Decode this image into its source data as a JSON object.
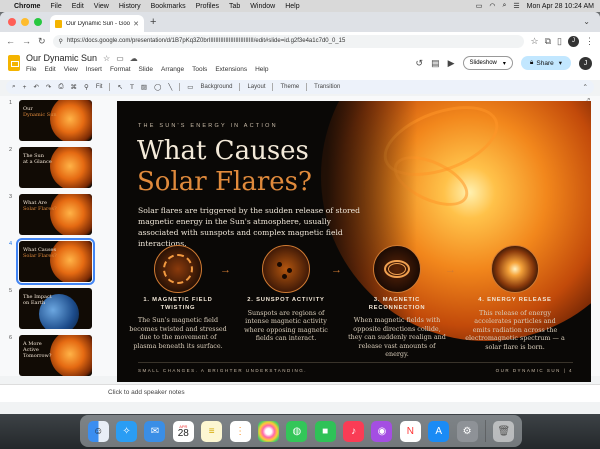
{
  "menubar": {
    "app": "Chrome",
    "items": [
      "File",
      "Edit",
      "View",
      "History",
      "Bookmarks",
      "Profiles",
      "Tab",
      "Window",
      "Help"
    ],
    "datetime": "Mon Apr 28  10:24 AM"
  },
  "browser": {
    "tab_title": "Our Dynamic Sun - Google Slides",
    "url": "https://docs.google.com/presentation/d/1B7pKq3Z0brIIIIIIIIIIIIIIIIIIIIIIIIIII/edit#slide=id.g2f3e4a1c7d0_0_15",
    "profile_initial": "J"
  },
  "doc": {
    "title": "Our Dynamic Sun",
    "menu": [
      "File",
      "Edit",
      "View",
      "Insert",
      "Format",
      "Slide",
      "Arrange",
      "Tools",
      "Extensions",
      "Help"
    ],
    "slideshow_label": "Slideshow",
    "share_label": "Share",
    "profile_initial": "J"
  },
  "edit_toolbar": {
    "zoom": "Fit",
    "background": "Background",
    "layout": "Layout",
    "theme": "Theme",
    "transition": "Transition"
  },
  "thumbnails": [
    {
      "num": "1",
      "title_a": "Our",
      "title_b": "Dynamic Sun"
    },
    {
      "num": "2",
      "title_a": "The Sun",
      "title_b": "at a Glance"
    },
    {
      "num": "3",
      "title_a": "What Are",
      "title_b": "Solar Flares?"
    },
    {
      "num": "4",
      "title_a": "What Causes",
      "title_b": "Solar Flares?"
    },
    {
      "num": "5",
      "title_a": "The Impact",
      "title_b": "on Earth"
    },
    {
      "num": "6",
      "title_a": "A More Active",
      "title_b": "Tomorrow?"
    }
  ],
  "slide": {
    "kicker": "THE SUN'S ENERGY IN ACTION",
    "title_a": "What Causes",
    "title_b": "Solar Flares?",
    "lead": "Solar flares are triggered by the sudden release of stored magnetic energy in the Sun's atmosphere, usually associated with sunspots and complex magnetic field interactions.",
    "steps": [
      {
        "title": "1. MAGNETIC FIELD TWISTING",
        "desc": "The Sun's magnetic field becomes twisted and stressed due to the movement of plasma beneath its surface."
      },
      {
        "title": "2. SUNSPOT ACTIVITY",
        "desc": "Sunspots are regions of intense magnetic activity where opposing magnetic fields can interact."
      },
      {
        "title": "3. MAGNETIC RECONNECTION",
        "desc": "When magnetic fields with opposite directions collide, they can suddenly realign and release vast amounts of energy."
      },
      {
        "title": "4. ENERGY RELEASE",
        "desc": "This release of energy accelerates particles and emits radiation across the electromagnetic spectrum — a solar flare is born."
      }
    ],
    "footer_left": "SMALL CHANGES. A BRIGHTER UNDERSTANDING.",
    "footer_right": "OUR DYNAMIC SUN  |  4"
  },
  "notes": {
    "placeholder": "Click to add speaker notes"
  },
  "dock_apps": [
    "finder",
    "safari",
    "mail",
    "calendar",
    "notes",
    "reminders",
    "photos",
    "messages",
    "facetime",
    "music",
    "podcasts",
    "news",
    "app-store",
    "system-settings",
    "trash"
  ],
  "dock_calendar": {
    "month": "APR",
    "day": "28"
  }
}
